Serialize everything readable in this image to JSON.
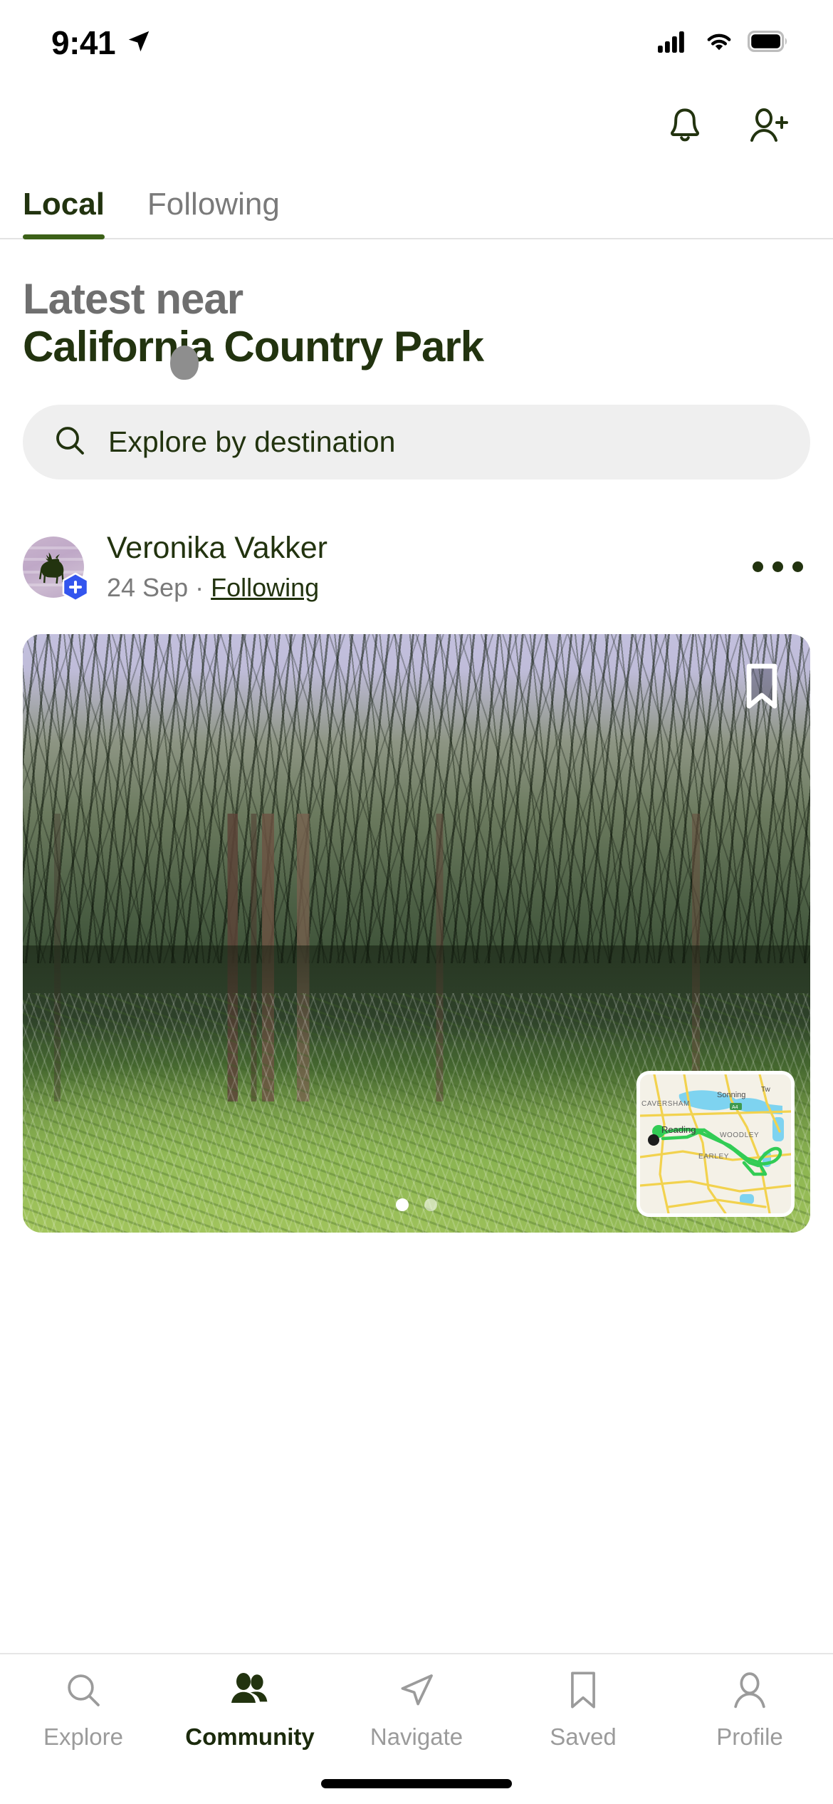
{
  "status_bar": {
    "time": "9:41",
    "location_icon": "location-arrow-icon",
    "cellular_icon": "cellular-signal-icon",
    "wifi_icon": "wifi-icon",
    "battery_icon": "battery-full-icon"
  },
  "top_bar": {
    "notifications_icon": "bell-icon",
    "add_friend_icon": "add-person-icon"
  },
  "tabs": [
    {
      "label": "Local",
      "active": true
    },
    {
      "label": "Following",
      "active": false
    }
  ],
  "heading": {
    "subtitle": "Latest near",
    "title": "California Country Park"
  },
  "search": {
    "icon": "search-icon",
    "placeholder": "Explore by destination",
    "value": ""
  },
  "post": {
    "avatar": {
      "icon": "deer-silhouette-avatar",
      "badge_icon": "plus-badge-icon",
      "badge_color": "#3355ee",
      "background_color": "#c3aecb"
    },
    "username": "Veronika Vakker",
    "date": "24 Sep",
    "separator": " · ",
    "relationship": "Following",
    "overflow_icon": "more-options-icon",
    "photo": {
      "alt": "forest-photo",
      "bookmark_icon": "bookmark-icon",
      "pagination": {
        "count": 2,
        "current": 1
      }
    },
    "mini_map": {
      "labels": [
        "CAVERSHAM",
        "Sonning",
        "Reading",
        "WOODLEY",
        "EARLEY",
        "Tw"
      ],
      "road_badge": "A4",
      "route_color": "#32cc55",
      "road_color": "#f2d24e",
      "water_color": "#74d0ef",
      "land_color": "#f3f0e6",
      "start_marker_color": "#1c1c1c"
    }
  },
  "bottom_nav": [
    {
      "label": "Explore",
      "icon": "search-icon",
      "active": false
    },
    {
      "label": "Community",
      "icon": "people-icon",
      "active": true
    },
    {
      "label": "Navigate",
      "icon": "paper-plane-icon",
      "active": false
    },
    {
      "label": "Saved",
      "icon": "bookmark-icon",
      "active": false
    },
    {
      "label": "Profile",
      "icon": "person-icon",
      "active": false
    }
  ],
  "colors": {
    "brand_green": "#22330f",
    "accent_green": "#3c6118",
    "muted_gray": "#7a7a7a",
    "search_bg": "#efefef"
  }
}
